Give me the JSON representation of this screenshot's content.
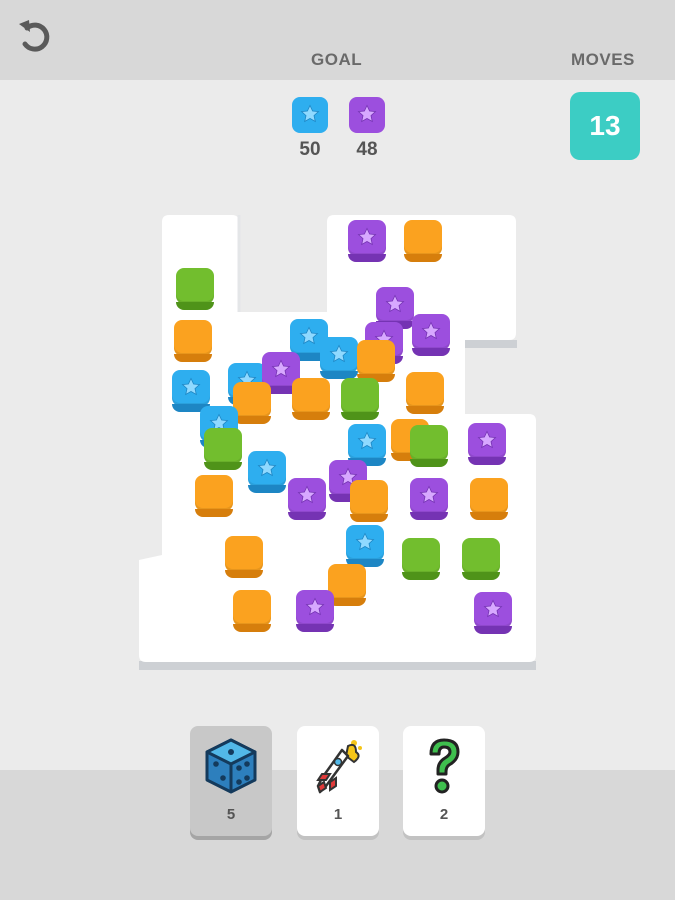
{
  "header": {
    "goal_label": "GOAL",
    "moves_label": "MOVES",
    "moves_value": "13"
  },
  "goals": [
    {
      "color": "blue",
      "count": "50"
    },
    {
      "color": "purple",
      "count": "48"
    }
  ],
  "colors": {
    "blue": "#2eaeef",
    "blue_dark": "#1d86c4",
    "purple": "#9c4fde",
    "purple_dark": "#7533b3",
    "orange": "#fba21f",
    "orange_dark": "#d67e0c",
    "green": "#72be2e",
    "green_dark": "#4f9319",
    "teal": "#3ccdc4",
    "board": "#ffffff",
    "board_side": "#d5d8dc"
  },
  "blocks": [
    {
      "color": "purple",
      "star": true
    },
    {
      "color": "orange",
      "star": false
    },
    {
      "color": "green",
      "star": false
    },
    {
      "color": "purple",
      "star": true
    },
    {
      "color": "orange",
      "star": false
    },
    {
      "color": "blue",
      "star": true
    },
    {
      "color": "purple",
      "star": true
    },
    {
      "color": "purple",
      "star": true
    },
    {
      "color": "blue",
      "star": true
    },
    {
      "color": "orange",
      "star": false
    },
    {
      "color": "blue",
      "star": true
    },
    {
      "color": "blue",
      "star": true
    },
    {
      "color": "purple",
      "star": true
    },
    {
      "color": "orange",
      "star": false
    },
    {
      "color": "orange",
      "star": false
    },
    {
      "color": "green",
      "star": false
    },
    {
      "color": "orange",
      "star": false
    },
    {
      "color": "blue",
      "star": true
    },
    {
      "color": "green",
      "star": false
    },
    {
      "color": "blue",
      "star": true
    },
    {
      "color": "orange",
      "star": false
    },
    {
      "color": "green",
      "star": false
    },
    {
      "color": "purple",
      "star": true
    },
    {
      "color": "blue",
      "star": true
    },
    {
      "color": "orange",
      "star": false
    },
    {
      "color": "purple",
      "star": true
    },
    {
      "color": "purple",
      "star": true
    },
    {
      "color": "orange",
      "star": false
    },
    {
      "color": "purple",
      "star": true
    },
    {
      "color": "orange",
      "star": false
    },
    {
      "color": "orange",
      "star": false
    },
    {
      "color": "blue",
      "star": true
    },
    {
      "color": "green",
      "star": false
    },
    {
      "color": "green",
      "star": false
    },
    {
      "color": "orange",
      "star": false
    },
    {
      "color": "orange",
      "star": false
    },
    {
      "color": "purple",
      "star": true
    },
    {
      "color": "purple",
      "star": true
    }
  ],
  "boosters": [
    {
      "name": "dice",
      "count": "5",
      "selected": true
    },
    {
      "name": "rocket",
      "count": "1",
      "selected": false
    },
    {
      "name": "question-mark",
      "count": "2",
      "selected": false
    }
  ]
}
